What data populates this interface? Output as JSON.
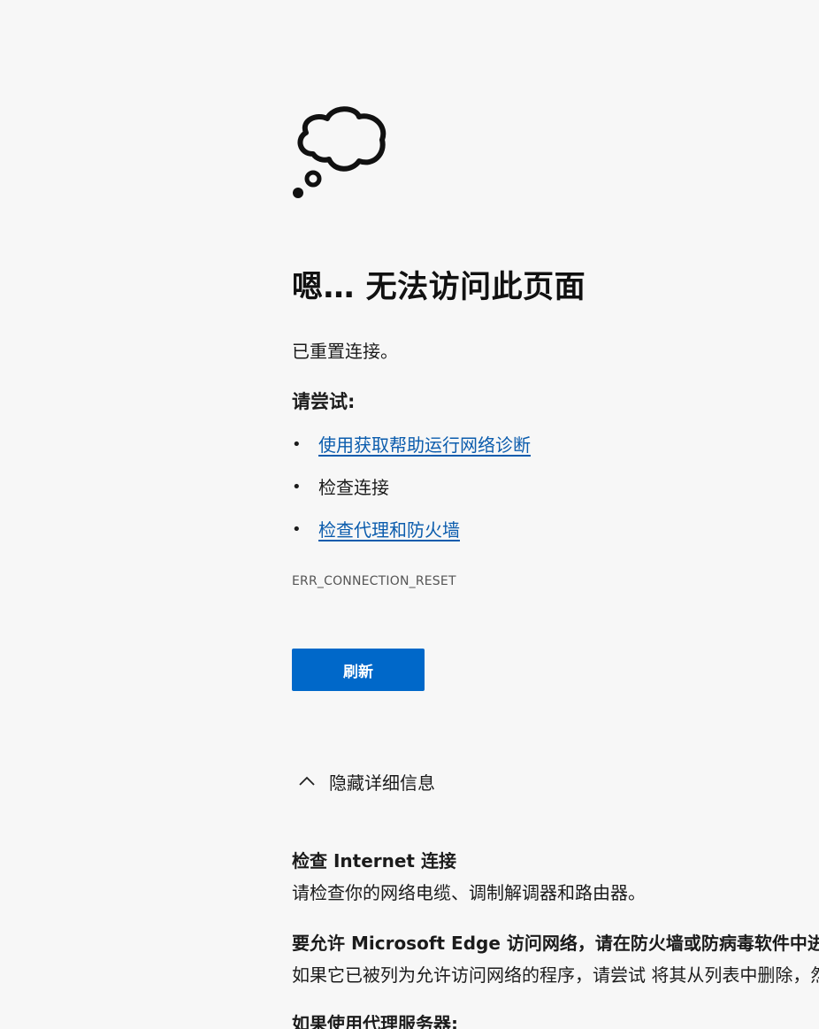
{
  "error_page": {
    "title": "嗯… 无法访问此页面",
    "subtitle": "已重置连接。",
    "try_heading": "请尝试:",
    "suggestions": [
      {
        "label": "使用获取帮助运行网络诊断",
        "link": true
      },
      {
        "label": "检查连接",
        "link": false
      },
      {
        "label": "检查代理和防火墙",
        "link": true
      }
    ],
    "error_code": "ERR_CONNECTION_RESET",
    "refresh_label": "刷新",
    "details_toggle_label": "隐藏详细信息",
    "details": [
      {
        "heading": "检查 Internet 连接",
        "text": "请检查你的网络电缆、调制解调器和路由器。"
      },
      {
        "heading": "要允许 Microsoft Edge 访问网络，请在防火墙或防病毒软件中进行设置",
        "text": "如果它已被列为允许访问网络的程序，请尝试 将其从列表中删除，然后重新添加。"
      },
      {
        "heading": "如果使用代理服务器:",
        "text": ""
      }
    ]
  },
  "icons": {
    "thought_bubble": "thought-bubble-icon",
    "chevron": "chevron-up-icon"
  },
  "colors": {
    "background": "#f7f7f7",
    "link": "#0b5cad",
    "button": "#0068c9",
    "button_text": "#ffffff"
  }
}
